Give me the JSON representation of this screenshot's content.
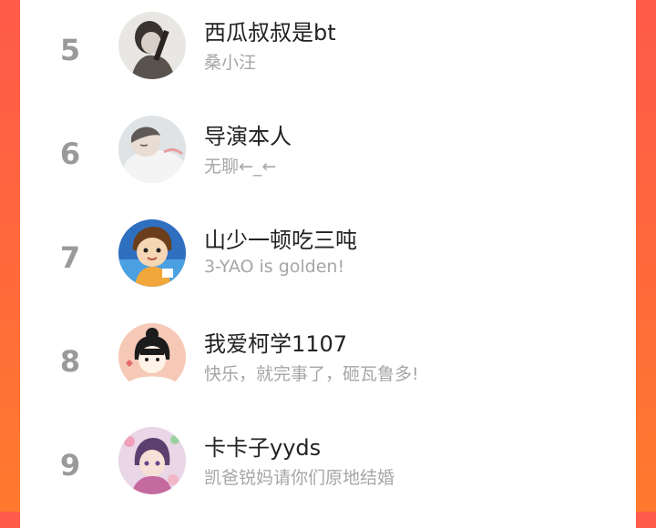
{
  "ranking": {
    "items": [
      {
        "rank": "5",
        "name": "西瓜叔叔是bt",
        "subtitle": "桑小汪",
        "avatar_icon": "avatar-ink-sketch-icon"
      },
      {
        "rank": "6",
        "name": "导演本人",
        "subtitle": "无聊←_←",
        "avatar_icon": "avatar-sleeping-boy-icon"
      },
      {
        "rank": "7",
        "name": "山少一顿吃三吨",
        "subtitle": "3-YAO is golden!",
        "avatar_icon": "avatar-cartoon-kid-icon"
      },
      {
        "rank": "8",
        "name": "我爱柯学1107",
        "subtitle": "快乐，就完事了，砸瓦鲁多!",
        "avatar_icon": "avatar-bun-girl-icon"
      },
      {
        "rank": "9",
        "name": "卡卡子yyds",
        "subtitle": "凯爸锐妈请你们原地结婚",
        "avatar_icon": "avatar-colorful-anime-icon"
      }
    ]
  },
  "colors": {
    "accent_gradient_top": "#ff5a4a",
    "accent_gradient_bottom": "#ff7a2e",
    "rank_gray": "#9a9a9a"
  }
}
